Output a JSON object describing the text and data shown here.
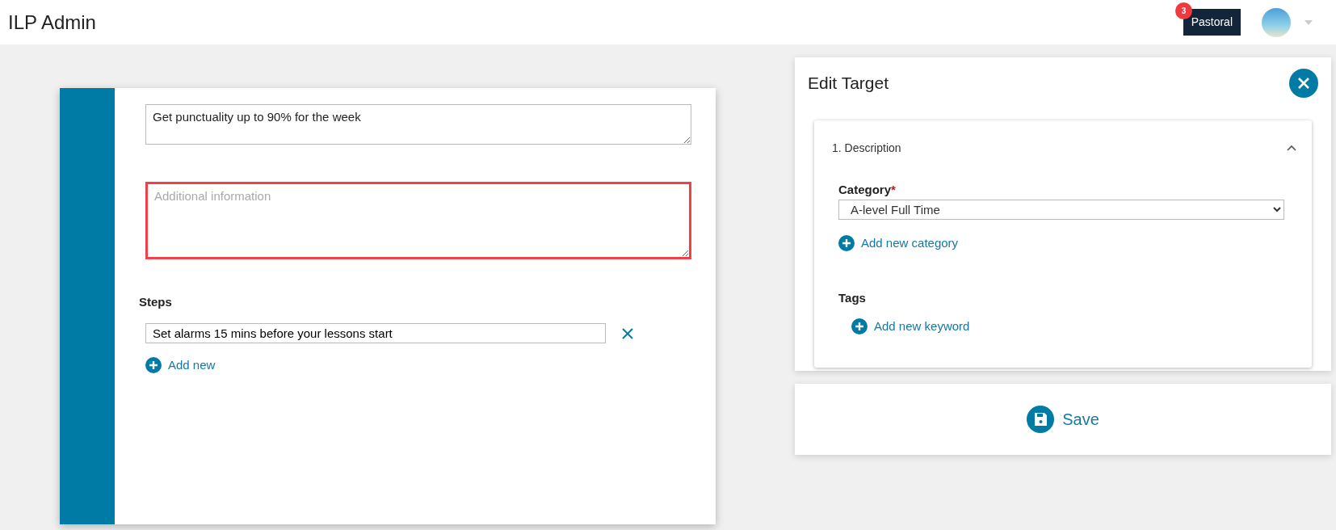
{
  "header": {
    "title": "ILP Admin",
    "notification_count": "3",
    "role_button": "Pastoral"
  },
  "form": {
    "target": {
      "value": "Get punctuality up to 90% for the week"
    },
    "additional_info": {
      "placeholder": "Additional information",
      "invalid": true
    },
    "steps_label": "Steps",
    "steps": [
      {
        "value": "Set alarms 15 mins before your lessons start"
      }
    ],
    "add_step": "Add new"
  },
  "panel": {
    "title": "Edit Target",
    "section": {
      "title": "1. Description",
      "expanded": true,
      "category_label": "Category",
      "category_required": "*",
      "category_value": "A-level Full Time",
      "add_category": "Add new category",
      "tags_label": "Tags",
      "add_keyword": "Add new keyword"
    }
  },
  "save": "Save"
}
